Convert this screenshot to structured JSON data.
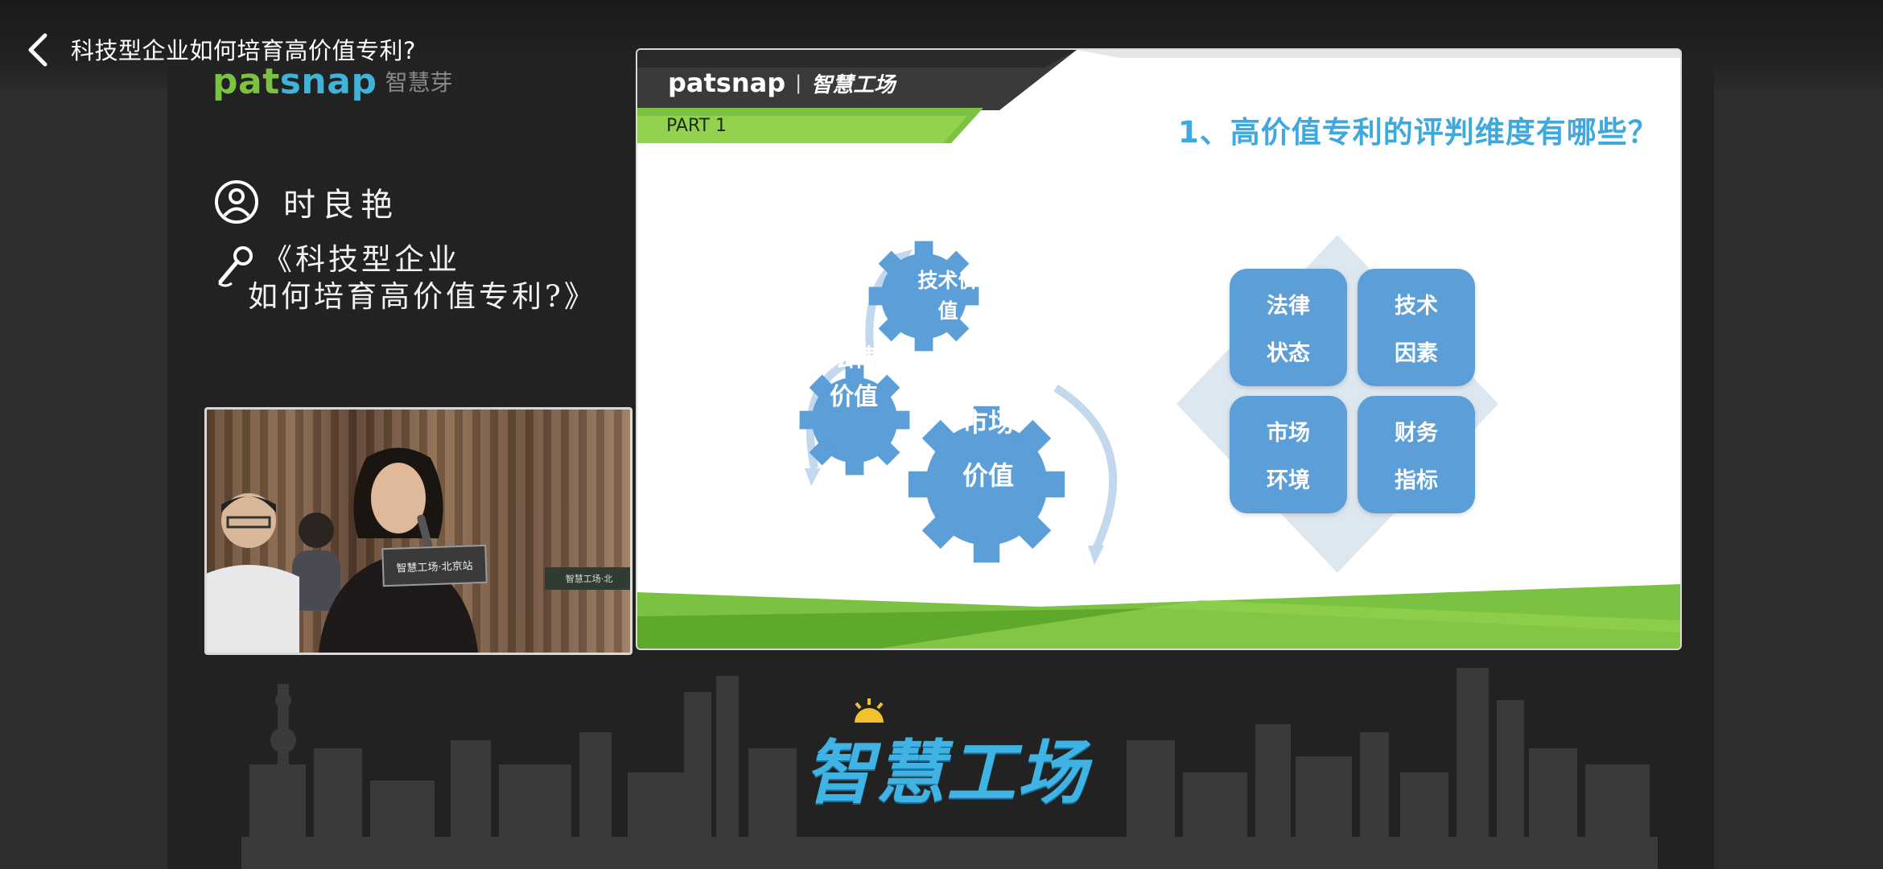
{
  "header": {
    "title": "科技型企业如何培育高价值专利?"
  },
  "brand": {
    "word_a": "pat",
    "word_b": "snap",
    "cn": "智慧芽"
  },
  "speaker": {
    "name": "时良艳",
    "topic_line1": "《科技型企业",
    "topic_line2": "如何培育高价值专利?》"
  },
  "camera": {
    "card_text": "智慧工场·北京站",
    "card2_text": "智慧工场·北"
  },
  "slide": {
    "logo_word": "patsnap",
    "logo_sep": "|",
    "logo_cn": "智慧工场",
    "part": "PART 1",
    "title": "1、高价值专利的评判维度有哪些？",
    "gears": [
      {
        "line1": "技术价",
        "line2": "值"
      },
      {
        "line1": "法律",
        "line2": "价值"
      },
      {
        "line1": "市场",
        "line2": "价值"
      }
    ],
    "quadrants": [
      {
        "line1": "法律",
        "line2": "状态"
      },
      {
        "line1": "技术",
        "line2": "因素"
      },
      {
        "line1": "市场",
        "line2": "环境"
      },
      {
        "line1": "财务",
        "line2": "指标"
      }
    ]
  },
  "bottom_brand": {
    "text": "智慧工场"
  },
  "colors": {
    "green": "#7cc242",
    "blue": "#3fa9dd",
    "gear_blue": "#5b9ed8"
  }
}
